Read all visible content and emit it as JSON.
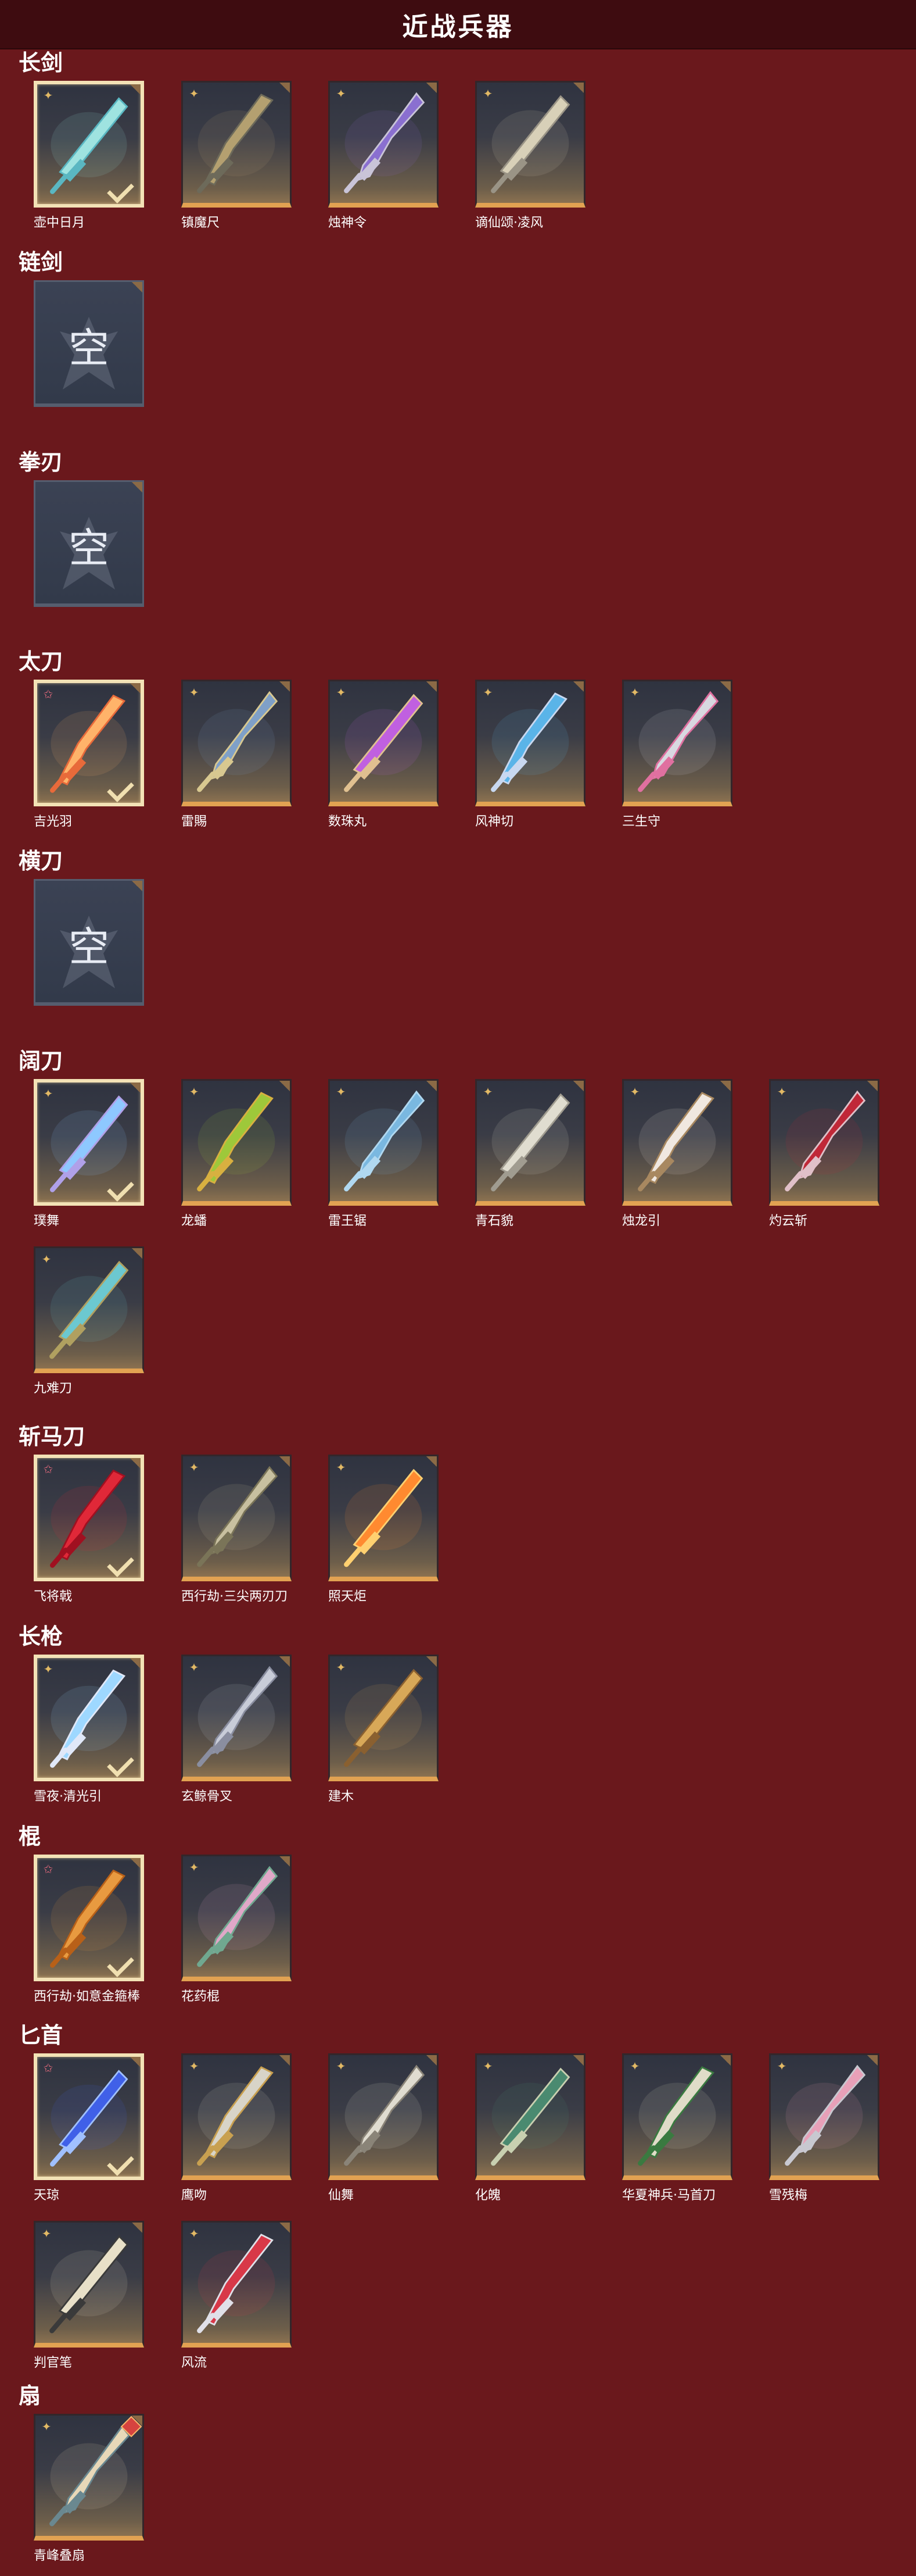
{
  "title": "近战兵器",
  "empty_label": "空",
  "categories": [
    {
      "name": "长剑",
      "items": [
        {
          "name": "壶中日月",
          "selected": true,
          "rarity": "gold",
          "c1": "#9fe3e0",
          "c2": "#5ab7c2"
        },
        {
          "name": "镇魔尺",
          "selected": false,
          "rarity": "gold",
          "c1": "#b4a070",
          "c2": "#6d6a5a"
        },
        {
          "name": "烛神令",
          "selected": false,
          "rarity": "gold",
          "c1": "#8a6fd0",
          "c2": "#c9c4d8"
        },
        {
          "name": "谪仙颂·凌风",
          "selected": false,
          "rarity": "gold",
          "c1": "#d8d0b8",
          "c2": "#9a9486"
        }
      ]
    },
    {
      "name": "链剑",
      "items": []
    },
    {
      "name": "拳刃",
      "items": []
    },
    {
      "name": "太刀",
      "items": [
        {
          "name": "吉光羽",
          "selected": true,
          "rarity": "pink",
          "c1": "#ffb36a",
          "c2": "#e86a3a"
        },
        {
          "name": "雷賜",
          "selected": false,
          "rarity": "gold",
          "c1": "#7fa0c8",
          "c2": "#d8c890"
        },
        {
          "name": "数珠丸",
          "selected": false,
          "rarity": "gold",
          "c1": "#c060e0",
          "c2": "#e0c090"
        },
        {
          "name": "风神切",
          "selected": false,
          "rarity": "gold",
          "c1": "#5ab4e8",
          "c2": "#c8d8f0"
        },
        {
          "name": "三生守",
          "selected": false,
          "rarity": "gold",
          "c1": "#d8d8e0",
          "c2": "#e070a0"
        }
      ]
    },
    {
      "name": "横刀",
      "items": []
    },
    {
      "name": "阔刀",
      "items": [
        {
          "name": "璞舞",
          "selected": true,
          "rarity": "gold",
          "c1": "#8ec8ff",
          "c2": "#b0a0e8"
        },
        {
          "name": "龙蟠",
          "selected": false,
          "rarity": "gold",
          "c1": "#9ec83a",
          "c2": "#d8b040"
        },
        {
          "name": "雷王锯",
          "selected": false,
          "rarity": "gold",
          "c1": "#7ab8e0",
          "c2": "#b0d8f0"
        },
        {
          "name": "青石貌",
          "selected": false,
          "rarity": "gold",
          "c1": "#e0ddd0",
          "c2": "#a09c90"
        },
        {
          "name": "烛龙引",
          "selected": false,
          "rarity": "gold",
          "c1": "#f0e8e0",
          "c2": "#a88860"
        },
        {
          "name": "灼云斩",
          "selected": false,
          "rarity": "gold",
          "c1": "#c02838",
          "c2": "#e0c0c8"
        },
        {
          "name": "九难刀",
          "selected": false,
          "rarity": "gold",
          "c1": "#6cc8d0",
          "c2": "#b0a060"
        }
      ]
    },
    {
      "name": "斩马刀",
      "items": [
        {
          "name": "飞将戟",
          "selected": true,
          "rarity": "pink",
          "c1": "#e02838",
          "c2": "#a01020"
        },
        {
          "name": "西行劫·三尖两刃刀",
          "selected": false,
          "rarity": "gold",
          "c1": "#c8c0a0",
          "c2": "#7a7458"
        },
        {
          "name": "照天炬",
          "selected": false,
          "rarity": "gold",
          "c1": "#ff8a30",
          "c2": "#ffd070"
        }
      ]
    },
    {
      "name": "长枪",
      "items": [
        {
          "name": "雪夜·清光引",
          "selected": true,
          "rarity": "gold",
          "c1": "#9ed8ff",
          "c2": "#e0e8f8"
        },
        {
          "name": "玄鲸骨叉",
          "selected": false,
          "rarity": "gold",
          "c1": "#c8ccd8",
          "c2": "#8a8ea0"
        },
        {
          "name": "建木",
          "selected": false,
          "rarity": "gold",
          "c1": "#d8a858",
          "c2": "#8a6030"
        }
      ]
    },
    {
      "name": "棍",
      "items": [
        {
          "name": "西行劫·如意金箍棒",
          "selected": true,
          "rarity": "pink",
          "c1": "#e89a40",
          "c2": "#b86018"
        },
        {
          "name": "花药棍",
          "selected": false,
          "rarity": "gold",
          "c1": "#e0a8c8",
          "c2": "#70a890"
        }
      ]
    },
    {
      "name": "匕首",
      "items": [
        {
          "name": "天琼",
          "selected": true,
          "rarity": "pink",
          "c1": "#4060e8",
          "c2": "#a0c0ff"
        },
        {
          "name": "鹰吻",
          "selected": false,
          "rarity": "gold",
          "c1": "#d8d4c8",
          "c2": "#c8a050"
        },
        {
          "name": "仙舞",
          "selected": false,
          "rarity": "gold",
          "c1": "#e0dcd0",
          "c2": "#8a8478"
        },
        {
          "name": "化魄",
          "selected": false,
          "rarity": "gold",
          "c1": "#4a8a70",
          "c2": "#c8d0b0"
        },
        {
          "name": "华夏神兵·马首刀",
          "selected": false,
          "rarity": "gold",
          "c1": "#e0dcc8",
          "c2": "#3a7a40"
        },
        {
          "name": "雪残梅",
          "selected": false,
          "rarity": "gold",
          "c1": "#e8a0b8",
          "c2": "#c8c8d0"
        },
        {
          "name": "判官笔",
          "selected": false,
          "rarity": "gold",
          "c1": "#e8e0c8",
          "c2": "#3a3a3a"
        },
        {
          "name": "风流",
          "selected": false,
          "rarity": "gold",
          "c1": "#d83848",
          "c2": "#e0e0e8"
        }
      ]
    },
    {
      "name": "扇",
      "items": [
        {
          "name": "青峰叠扇",
          "selected": false,
          "rarity": "gold",
          "gem": true,
          "c1": "#e8d8b8",
          "c2": "#6a8890"
        }
      ]
    }
  ]
}
